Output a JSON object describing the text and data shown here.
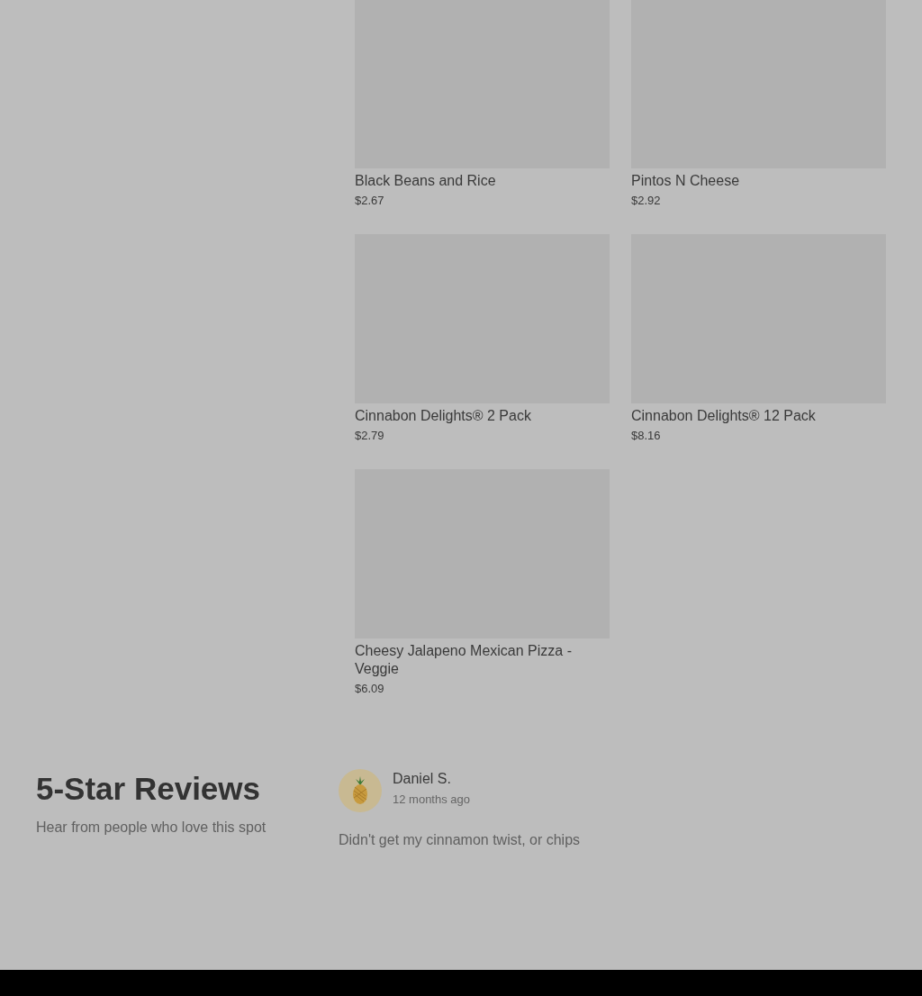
{
  "products": [
    {
      "name": "Black Beans and Rice",
      "price": "$2.67"
    },
    {
      "name": "Pintos N Cheese",
      "price": "$2.92"
    },
    {
      "name": "Cinnabon Delights® 2 Pack",
      "price": "$2.79"
    },
    {
      "name": "Cinnabon Delights® 12 Pack",
      "price": "$8.16"
    },
    {
      "name": "Cheesy Jalapeno Mexican Pizza - Veggie",
      "price": "$6.09"
    }
  ],
  "reviews_section": {
    "title": "5-Star Reviews",
    "subtitle": "Hear from people who love this spot",
    "reviews": [
      {
        "author": "Daniel S.",
        "time": "12 months ago",
        "text": "Didn't get my cinnamon twist, or chips"
      }
    ]
  }
}
